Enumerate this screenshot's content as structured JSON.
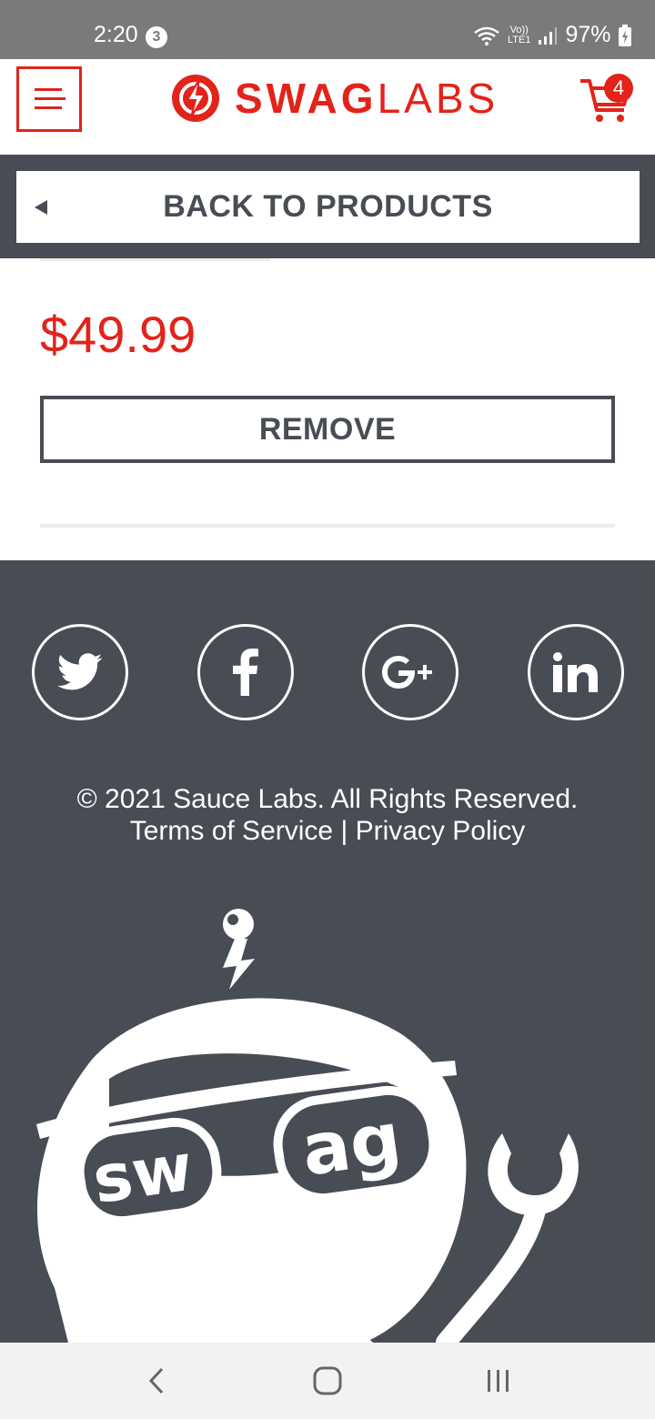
{
  "status_bar": {
    "time": "2:20",
    "notification_count": "3",
    "network_line1": "Vo))",
    "network_line2": "LTE1",
    "battery": "97%",
    "icons": [
      "wifi-icon",
      "signal-icon",
      "battery-charging-icon"
    ]
  },
  "header": {
    "logo_bold": "SWAG",
    "logo_light": "LABS",
    "cart_count": "4",
    "icons": [
      "menu-icon",
      "swag-labs-logo-icon",
      "cart-icon"
    ]
  },
  "back": {
    "label": "BACK TO PRODUCTS",
    "icon": "back-arrow-icon"
  },
  "product": {
    "price": "$49.99",
    "remove_label": "REMOVE"
  },
  "footer": {
    "social_icons": [
      "twitter-icon",
      "facebook-icon",
      "google-plus-icon",
      "linkedin-icon"
    ],
    "copyright": "© 2021 Sauce Labs. All Rights Reserved.",
    "terms": "Terms of Service",
    "separator": "|",
    "privacy": "Privacy Policy",
    "mascot_text_left": "sw",
    "mascot_text_right": "ag"
  },
  "nav_bar": {
    "icons": [
      "nav-back-icon",
      "nav-home-icon",
      "nav-recents-icon"
    ]
  },
  "colors": {
    "brand_red": "#e2231a",
    "dark_slate": "#484c55",
    "status_gray": "#7a7a7a"
  }
}
